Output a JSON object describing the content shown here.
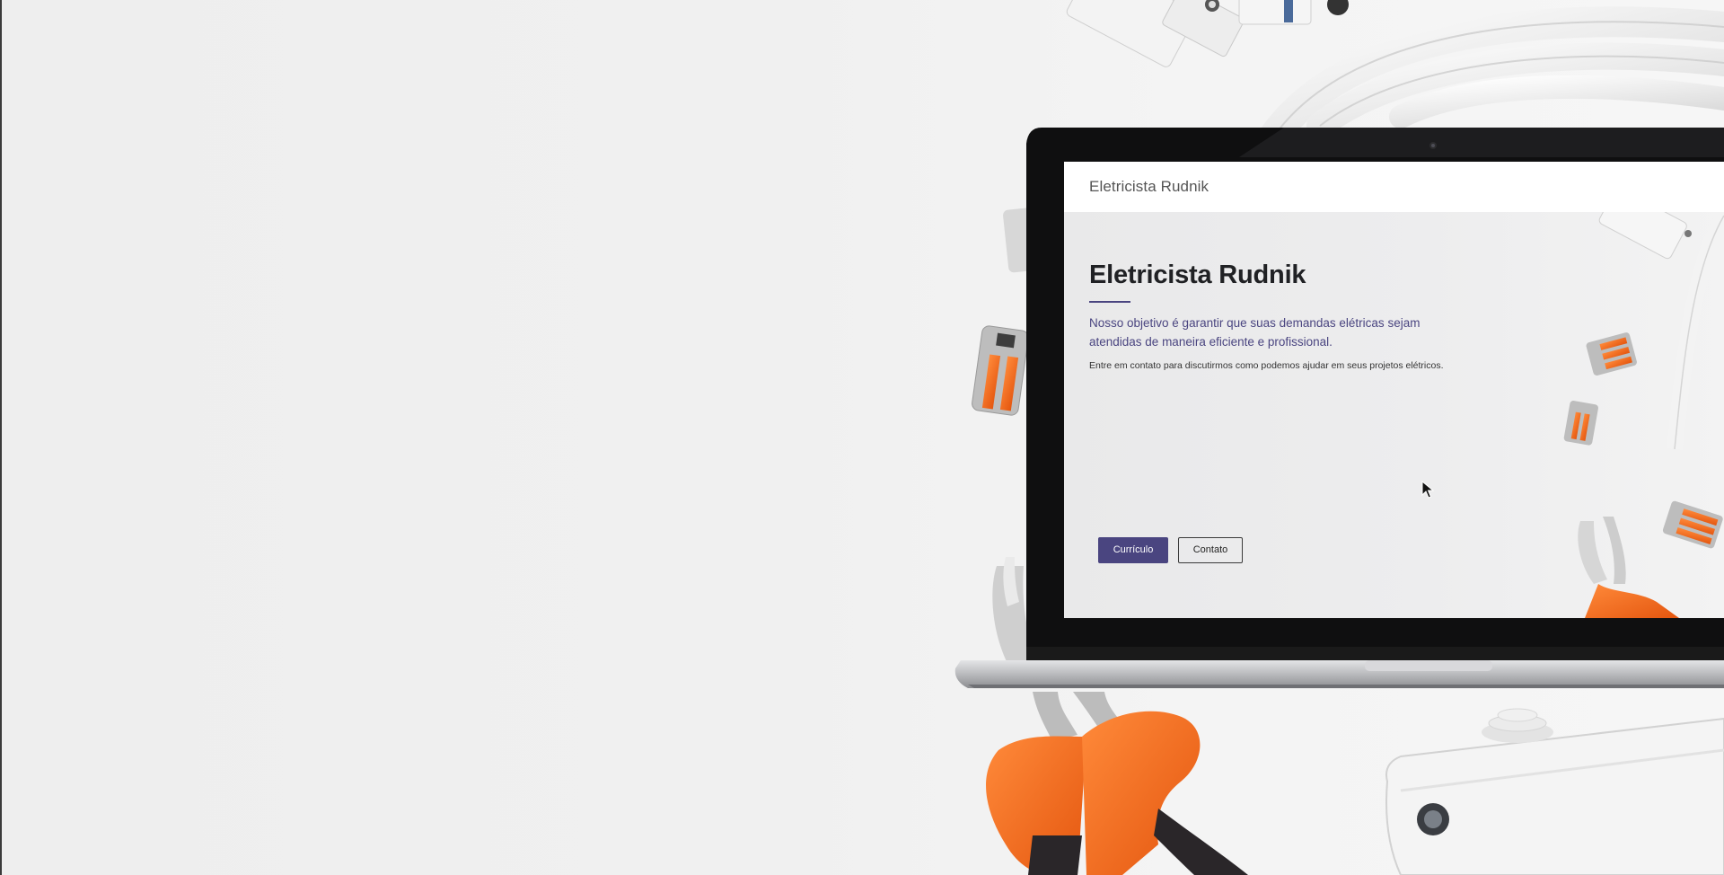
{
  "site": {
    "brand": "Eletricista Rudnik"
  },
  "hero": {
    "title": "Eletricista Rudnik",
    "subtitle": "Nosso objetivo é garantir que suas demandas elétricas sejam atendidas de maneira eficiente e profissional.",
    "note": "Entre em contato para discutirmos como podemos ajudar em seus projetos elétricos."
  },
  "buttons": {
    "curriculo": "Currículo",
    "contato": "Contato"
  },
  "colors": {
    "accent": "#4a4580",
    "tool_orange": "#f36f21",
    "laptop_bezel": "#0f0f10",
    "laptop_silver": "#c9cacd"
  }
}
